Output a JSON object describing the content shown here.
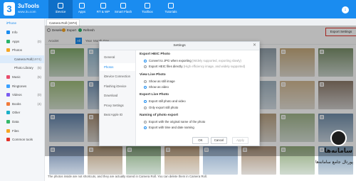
{
  "app": {
    "name": "3uTools",
    "site": "www.3u.com",
    "logo_char": "3"
  },
  "nav_tabs": [
    {
      "label": "iDevice",
      "active": true
    },
    {
      "label": "Apps",
      "active": false
    },
    {
      "label": "RT & WP",
      "active": false
    },
    {
      "label": "Smart Flash",
      "active": false
    },
    {
      "label": "Toolbox",
      "active": false
    },
    {
      "label": "Tutorials",
      "active": false
    }
  ],
  "sidebar": {
    "device": "iPhone",
    "items": [
      {
        "label": "Info",
        "count": "",
        "sub": false,
        "selected": false,
        "color": "#1a8cf0"
      },
      {
        "label": "Apps",
        "count": "(0)",
        "sub": false,
        "selected": false,
        "color": "#29b36a"
      },
      {
        "label": "Photos",
        "count": "",
        "sub": false,
        "selected": false,
        "color": "#f5a623"
      },
      {
        "label": "Camera Roll",
        "count": "(1974)",
        "sub": true,
        "selected": true,
        "color": "#f5a623"
      },
      {
        "label": "Photo Library",
        "count": "(5)",
        "sub": true,
        "selected": false,
        "color": "#f5a623"
      },
      {
        "label": "Music",
        "count": "(5)",
        "sub": false,
        "selected": false,
        "color": "#e84d6c"
      },
      {
        "label": "Ringtones",
        "count": "",
        "sub": false,
        "selected": false,
        "color": "#3aa0ff"
      },
      {
        "label": "Videos",
        "count": "(0)",
        "sub": false,
        "selected": false,
        "color": "#7b5cf0"
      },
      {
        "label": "Books",
        "count": "(4)",
        "sub": false,
        "selected": false,
        "color": "#f07a3a"
      },
      {
        "label": "Other",
        "count": "",
        "sub": false,
        "selected": false,
        "color": "#1ab0c9"
      },
      {
        "label": "Data",
        "count": "",
        "sub": false,
        "selected": false,
        "color": "#35b86a"
      },
      {
        "label": "Files",
        "count": "",
        "sub": false,
        "selected": false,
        "color": "#f5a623"
      },
      {
        "label": "Common tools",
        "count": "",
        "sub": false,
        "selected": false,
        "color": "#e2332b"
      }
    ]
  },
  "path_tab": "Camera Roll (1974)",
  "toolbar": {
    "delete": "Deselect",
    "export": "Export",
    "refresh": "Refresh",
    "export_settings": "Export Settings"
  },
  "filters": {
    "select_all": "Aroolet",
    "tabs": [
      "All",
      "Year",
      "Month",
      "Day"
    ]
  },
  "thumb_colors": [
    [
      "#7fa86a",
      "#8bb2c9",
      "#c99a6a",
      "#6e9bc4",
      "#b6c49a",
      "#8f9ea8",
      "#c4a87a",
      "#7a8f6a"
    ],
    [
      "#9dbb7a",
      "#6f8fb0",
      "#b58a5a",
      "#86a6c8",
      "#c9b07a",
      "#a0b3c0",
      "#d0b690",
      "#8c7a6a"
    ],
    [
      "#5e7fa6",
      "#a38a70",
      "#89a86e",
      "#c9a17a",
      "#7d99b8",
      "#b8a080",
      "#9fb48a",
      "#6f8ca8"
    ],
    [
      "#6a7fa0",
      "#a88f70",
      "#7f9f76",
      "#b99c7a",
      "#88a2bf",
      "#a89078",
      "#93ab7e",
      "#7896b0"
    ]
  ],
  "bottom_note": "The photos inside are not shortcuts, and they are actually stored in Camera Roll. You can delete them in Camera Roll.",
  "dialog": {
    "title": "Settings",
    "close": "✕",
    "nav": [
      "General",
      "Photos",
      "iDevice Connection",
      "Flashing iDevice",
      "Download",
      "Proxy Settings",
      "Beat Apple ID"
    ],
    "nav_active": 1,
    "sections": [
      {
        "title": "Export HEIC Photo",
        "options": [
          {
            "label": "Convert to JPG when exporting",
            "hint": "(Widely supported, exporting slowly)",
            "on": true
          },
          {
            "label": "Export HEIC files directly",
            "hint": "(High efficiency image, and widely supported)",
            "on": false
          }
        ]
      },
      {
        "title": "View Live Photo",
        "options": [
          {
            "label": "Show as still image",
            "hint": "",
            "on": false
          },
          {
            "label": "Show as video",
            "hint": "",
            "on": true
          }
        ]
      },
      {
        "title": "Export Live Photo",
        "options": [
          {
            "label": "Export still photo and video",
            "hint": "",
            "on": true
          },
          {
            "label": "Only export still photo",
            "hint": "",
            "on": false
          }
        ]
      },
      {
        "title": "Naming of photo export",
        "options": [
          {
            "label": "Export with the original name of the photo",
            "hint": "",
            "on": false
          },
          {
            "label": "Export with time and date naming",
            "hint": "",
            "on": true
          }
        ]
      }
    ],
    "buttons": {
      "ok": "OK",
      "cancel": "Cancel",
      "apply": "Apply"
    }
  },
  "watermark": {
    "title": "سامانه‌ها",
    "subtitle": "پورتال جامع سامانه‌ها"
  }
}
